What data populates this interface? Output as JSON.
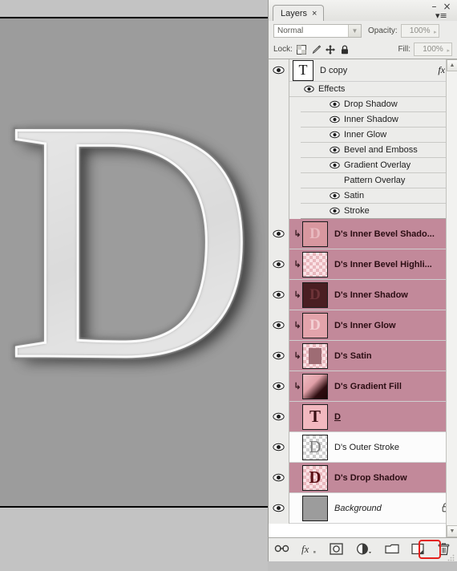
{
  "window": {
    "minimize_label": "–",
    "close_label": "×",
    "panel_menu_label": "▾≡"
  },
  "panel": {
    "tab_label": "Layers",
    "tab_close_label": "×",
    "blend_mode": "Normal",
    "blend_dropdown_arrow": "▼",
    "opacity_label": "Opacity:",
    "opacity_value": "100%",
    "opacity_arrow": "▸",
    "lock_label": "Lock:",
    "lock_icons": [
      "transparency-lock-icon",
      "paint-lock-icon",
      "move-lock-icon",
      "all-lock-icon"
    ],
    "fill_label": "Fill:",
    "fill_value": "100%",
    "fill_arrow": "▸"
  },
  "layers": [
    {
      "name": "D copy",
      "type": "text",
      "thumb": "T",
      "visible": true,
      "selected": false,
      "fx_badge": "fx",
      "expand_arrow": "▲",
      "effects_group_label": "Effects",
      "effects": [
        {
          "label": "Drop Shadow",
          "visible": true
        },
        {
          "label": "Inner Shadow",
          "visible": true
        },
        {
          "label": "Inner Glow",
          "visible": true
        },
        {
          "label": "Bevel and Emboss",
          "visible": true
        },
        {
          "label": "Gradient Overlay",
          "visible": true
        },
        {
          "label": "Pattern Overlay",
          "visible": false
        },
        {
          "label": "Satin",
          "visible": true
        },
        {
          "label": "Stroke",
          "visible": true
        }
      ]
    },
    {
      "name": "D's Inner Bevel Shado...",
      "type": "raster",
      "thumb": "checker-pink-d",
      "visible": true,
      "selected": true,
      "clipped": true,
      "clip_arrow": "↳"
    },
    {
      "name": "D's Inner Bevel Highli...",
      "type": "raster",
      "thumb": "checker-pink",
      "visible": true,
      "selected": true,
      "clipped": true,
      "clip_arrow": "↳"
    },
    {
      "name": "D's Inner Shadow",
      "type": "raster",
      "thumb": "dark-maroon-d",
      "visible": true,
      "selected": true,
      "clipped": true,
      "clip_arrow": "↳"
    },
    {
      "name": "D's Inner Glow",
      "type": "raster",
      "thumb": "pink-glow-d",
      "visible": true,
      "selected": true,
      "clipped": true,
      "clip_arrow": "↳"
    },
    {
      "name": "D's Satin",
      "type": "raster",
      "thumb": "checker-satin",
      "visible": true,
      "selected": true,
      "clipped": true,
      "clip_arrow": "↳"
    },
    {
      "name": "D's Gradient Fill",
      "type": "raster",
      "thumb": "gradient-pink-maroon",
      "visible": true,
      "selected": true,
      "clipped": true,
      "clip_arrow": "↳"
    },
    {
      "name": "D",
      "type": "text",
      "thumb": "T",
      "visible": true,
      "selected": true,
      "clipped": false
    },
    {
      "name": "D's Outer Stroke",
      "type": "raster",
      "thumb": "checker-gray-d",
      "visible": true,
      "selected": false,
      "clipped": false
    },
    {
      "name": "D's Drop Shadow",
      "type": "raster",
      "thumb": "checker-pink-red-d",
      "visible": true,
      "selected": true,
      "clipped": false
    },
    {
      "name": "Background",
      "type": "background",
      "thumb": "solid-gray",
      "visible": true,
      "selected": false,
      "locked": true,
      "lock_icon": "padlock-icon"
    }
  ],
  "bottom_toolbar": {
    "buttons": [
      {
        "name": "link-layers-button",
        "icon": "link-icon"
      },
      {
        "name": "add-layer-style-button",
        "icon": "fx-icon",
        "label": "fx"
      },
      {
        "name": "add-layer-mask-button",
        "icon": "mask-circle-icon"
      },
      {
        "name": "new-fill-adjustment-button",
        "icon": "half-circle-icon"
      },
      {
        "name": "new-group-button",
        "icon": "folder-icon"
      },
      {
        "name": "new-layer-button",
        "icon": "new-layer-icon"
      },
      {
        "name": "delete-layer-button",
        "icon": "trash-icon",
        "highlighted": true,
        "highlight_color": "#e4201c"
      }
    ]
  },
  "canvas": {
    "letter": "D",
    "background_color": "#9c9c9c",
    "letter_description": "metallic beveled serif capital D"
  },
  "scrollbar": {
    "up_arrow": "▲",
    "down_arrow": "▼"
  }
}
